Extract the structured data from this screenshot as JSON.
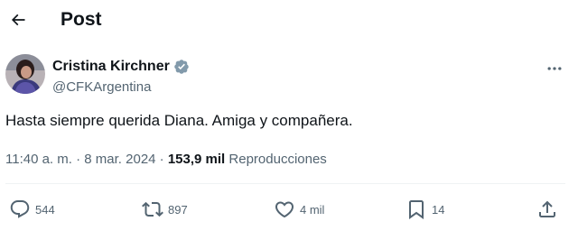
{
  "header": {
    "title": "Post"
  },
  "author": {
    "name": "Cristina Kirchner",
    "handle": "@CFKArgentina"
  },
  "tweet": {
    "text": "Hasta siempre querida Diana. Amiga y compañera."
  },
  "meta": {
    "time": "11:40 a. m.",
    "separator": " · ",
    "date": "8 mar. 2024",
    "views_count": "153,9 mil",
    "views_label": "Reproducciones"
  },
  "actions": {
    "replies": "544",
    "reposts": "897",
    "likes": "4 mil",
    "bookmarks": "14"
  },
  "colors": {
    "text": "#0f1419",
    "secondary": "#536471",
    "verified": "#829aab",
    "divider": "#eff3f4"
  }
}
